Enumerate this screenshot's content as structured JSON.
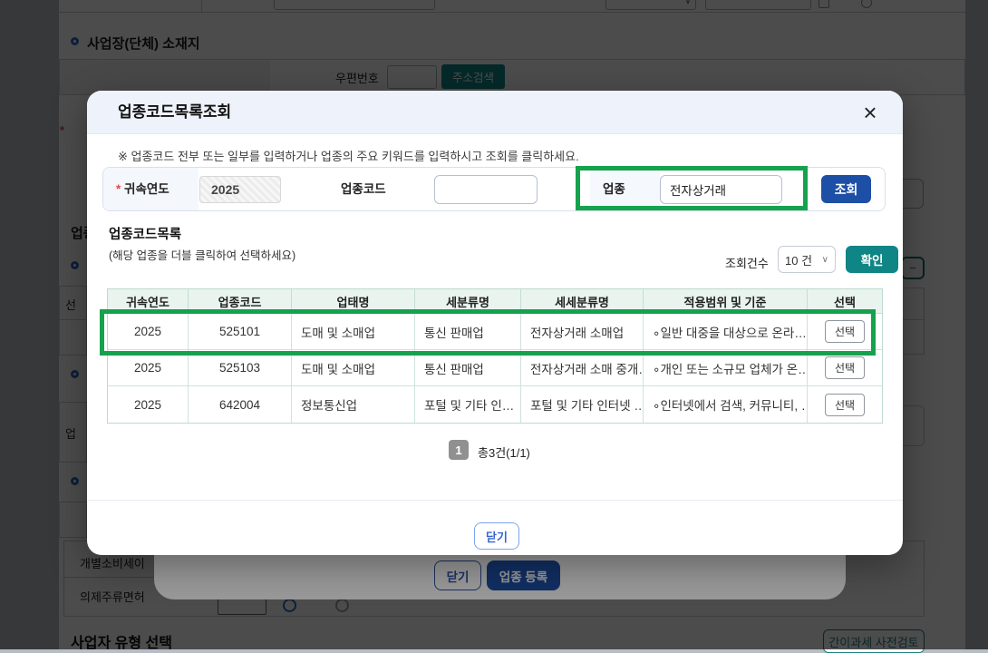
{
  "modal": {
    "title": "업종코드목록조회",
    "close_icon": "×",
    "instruction": "※ 업종코드 전부 또는 일부를 입력하거나 업종의 주요 키워드를 입력하시고 조회를 클릭하세요.",
    "form": {
      "required_mark": "*",
      "year_label": "귀속연도",
      "year_value": "2025",
      "code_label": "업종코드",
      "code_value": "",
      "industry_label": "업종",
      "industry_value": "전자상거래",
      "search_button": "조회"
    },
    "list": {
      "heading": "업종코드목록",
      "subheading": "(해당 업종을 더블 클릭하여 선택하세요)",
      "count_label": "조회건수",
      "count_value": "10 건",
      "count_chevron": "∨",
      "confirm_button": "확인",
      "columns": [
        "귀속연도",
        "업종코드",
        "업태명",
        "세분류명",
        "세세분류명",
        "적용범위 및 기준",
        "선택"
      ],
      "rows": [
        {
          "year": "2025",
          "code": "525101",
          "category": "도매 및 소매업",
          "subclass": "통신 판매업",
          "detail": "전자상거래 소매업",
          "scope": "∘일반 대중을 대상으로 온라…",
          "select_button": "선택"
        },
        {
          "year": "2025",
          "code": "525103",
          "category": "도매 및 소매업",
          "subclass": "통신 판매업",
          "detail": "전자상거래 소매 중개…",
          "scope": "∘개인 또는 소규모 업체가 온…",
          "select_button": "선택"
        },
        {
          "year": "2025",
          "code": "642004",
          "category": "정보통신업",
          "subclass": "포털 및 기타 인…",
          "detail": "포털 및 기타 인터넷 …",
          "scope": "∘인터넷에서 검색, 커뮤니티, …",
          "select_button": "선택"
        }
      ],
      "page_number": "1",
      "total_text": "총3건(1/1)"
    },
    "close_button": "닫기"
  },
  "back_dialog": {
    "close_button": "닫기",
    "register_button": "업종 등록"
  },
  "background": {
    "section_title": "사업장(단체) 소재지",
    "postcode_label": "우편번호",
    "address_search_button": "주소검색",
    "required_fragment": "*",
    "left_fragments": {
      "industry_heading": "업종",
      "row_char": "선",
      "box_char": "업"
    },
    "minus_button": "−",
    "excise_label": "개별소비세이",
    "liquor_label": "의제주류면허",
    "business_type_title": "사업자 유형 선택",
    "simplified_check_button": "간이과세 사전검토"
  },
  "colors": {
    "primary_blue": "#1d4fa6",
    "teal": "#0f8585",
    "annotation_green": "#15a24c",
    "table_header_bg": "#e9f4ef"
  }
}
